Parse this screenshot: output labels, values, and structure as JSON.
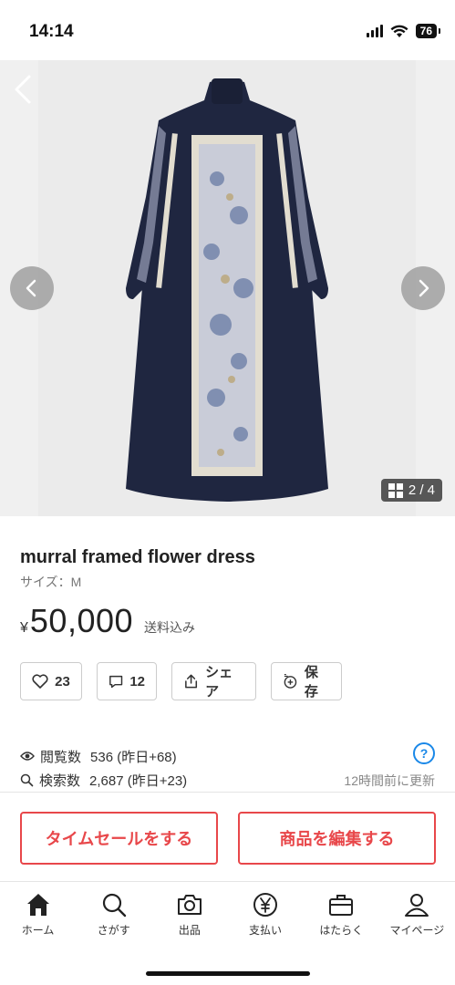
{
  "status": {
    "time": "14:14",
    "battery": "76"
  },
  "gallery": {
    "counter": "2 / 4"
  },
  "product": {
    "title": "murral framed flower dress",
    "size": "サイズ：M",
    "price_currency": "¥",
    "price": "50,000",
    "shipping_note": "送料込み"
  },
  "actions": {
    "like_count": "23",
    "comment_count": "12",
    "share_label": "シェア",
    "save_label": "保存"
  },
  "stats": {
    "views_label": "閲覧数",
    "views_value": "536 (昨日+68)",
    "search_label": "検索数",
    "search_value": "2,687 (昨日+23)",
    "updated": "12時間前に更新"
  },
  "cta": {
    "timesale": "タイムセールをする",
    "edit": "商品を編集する"
  },
  "tabs": [
    {
      "label": "ホーム",
      "icon": "home-icon"
    },
    {
      "label": "さがす",
      "icon": "search-icon"
    },
    {
      "label": "出品",
      "icon": "camera-icon"
    },
    {
      "label": "支払い",
      "icon": "yen-icon"
    },
    {
      "label": "はたらく",
      "icon": "briefcase-icon"
    },
    {
      "label": "マイページ",
      "icon": "person-icon"
    }
  ],
  "colors": {
    "accent": "#e8474a",
    "link": "#1a88e8",
    "dress_navy": "#1f2640"
  }
}
